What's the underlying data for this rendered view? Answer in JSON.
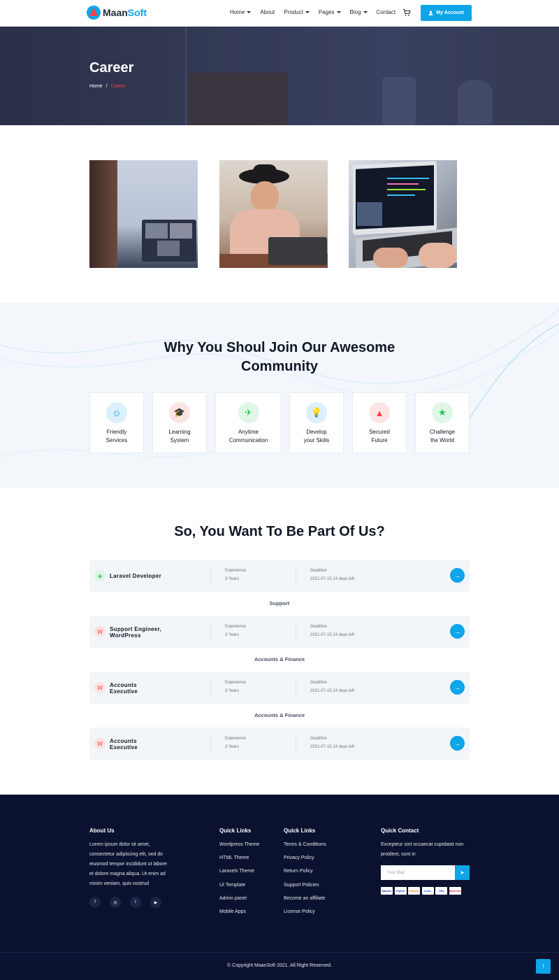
{
  "header": {
    "logo_part1": "Maan",
    "logo_part2": "Soft",
    "nav": [
      {
        "label": "Home",
        "dropdown": true
      },
      {
        "label": "About",
        "dropdown": false
      },
      {
        "label": "Product",
        "dropdown": true
      },
      {
        "label": "Pages",
        "dropdown": true
      },
      {
        "label": "Blog",
        "dropdown": true
      },
      {
        "label": "Contact",
        "dropdown": false
      }
    ],
    "cart_icon": "cart-icon",
    "account_label": "My Account"
  },
  "banner": {
    "title": "Career",
    "breadcrumb_home": "Home",
    "breadcrumb_sep": "/",
    "breadcrumb_current": "Career"
  },
  "community": {
    "title_line1": "Why You Shoul Join Our Awesome",
    "title_line2": "Community",
    "features": [
      {
        "line1": "Friendly",
        "line2": "Services",
        "icon": "support-agent-icon",
        "color": "#0ea5e9",
        "bg": "#dbeffd"
      },
      {
        "line1": "Learning",
        "line2": "System",
        "icon": "graduation-cap-icon",
        "color": "#ef4444",
        "bg": "#fde4e4"
      },
      {
        "line1": "Anytime",
        "line2": "Communication",
        "icon": "paper-plane-icon",
        "color": "#22c55e",
        "bg": "#e0f6e6"
      },
      {
        "line1": "Develop",
        "line2": "your Skills",
        "icon": "lightbulb-icon",
        "color": "#0ea5e9",
        "bg": "#dbeffd"
      },
      {
        "line1": "Secured",
        "line2": "Future",
        "icon": "growth-chart-icon",
        "color": "#ef4444",
        "bg": "#fde4e4"
      },
      {
        "line1": "Challenge",
        "line2": "the World",
        "icon": "stairs-star-icon",
        "color": "#22c55e",
        "bg": "#e0f6e6"
      }
    ]
  },
  "jobs": {
    "title": "So, You Want To Be Part Of Us?",
    "experience_label": "Experience",
    "deadline_label": "Deadline",
    "items": [
      {
        "category": "",
        "title_line1": "Laravel Developer",
        "title_line2": "",
        "icon": "laravel-icon",
        "experience": "3 Years",
        "deadline": "2021-07-15 24 days left"
      },
      {
        "category": "Support",
        "title_line1": "Support Engineer,",
        "title_line2": "WordPress",
        "icon": "wordpress-icon",
        "experience": "3 Years",
        "deadline": "2021-07-15 24 days left"
      },
      {
        "category": "Accounts & Finance",
        "title_line1": "Accounts",
        "title_line2": "Executive",
        "icon": "wordpress-icon",
        "experience": "3 Years",
        "deadline": "2021-07-15 24 days left"
      },
      {
        "category": "Accounts & Finance",
        "title_line1": "Accounts",
        "title_line2": "Executive",
        "icon": "wordpress-icon",
        "experience": "3 Years",
        "deadline": "2021-07-15 24 days left"
      }
    ]
  },
  "footer": {
    "about_title": "About Us",
    "about_text": [
      "Lorem ipsum dolor sit amet,",
      "consectetur adipiscing elit, sed do",
      "eiusmod tempor incididunt ut labore",
      "et dolore magna aliqua. Ut enim ad",
      "minim veniam, quis nostrud"
    ],
    "social": [
      {
        "icon": "facebook-icon",
        "glyph": "f"
      },
      {
        "icon": "instagram-icon",
        "glyph": "◎"
      },
      {
        "icon": "twitter-icon",
        "glyph": "t"
      },
      {
        "icon": "youtube-icon",
        "glyph": "▶"
      }
    ],
    "links1_title": "Quick Links",
    "links1": [
      "Wordpress Theme",
      "HTML Theme",
      "Laravels Theme",
      "UI Template",
      "Admin panel",
      "Mobile Apps"
    ],
    "links2_title": "Quick Links",
    "links2": [
      "Terms & Conditions",
      "Privacy Policy",
      "Return Policy",
      "Support Policies",
      "Become an affiliate",
      "License Policy"
    ],
    "contact_title": "Quick Contact",
    "contact_text": [
      "Excepteur sint occaecat cupidatat non",
      "proident, sunt in"
    ],
    "mail_placeholder": "Your Mail",
    "payments": [
      "Maestro",
      "PayPal",
      "Discover",
      "AmEx",
      "VISA",
      "MasterCard"
    ],
    "copyright": "© Copyright MaanSoft 2021. All Right Reserved."
  }
}
